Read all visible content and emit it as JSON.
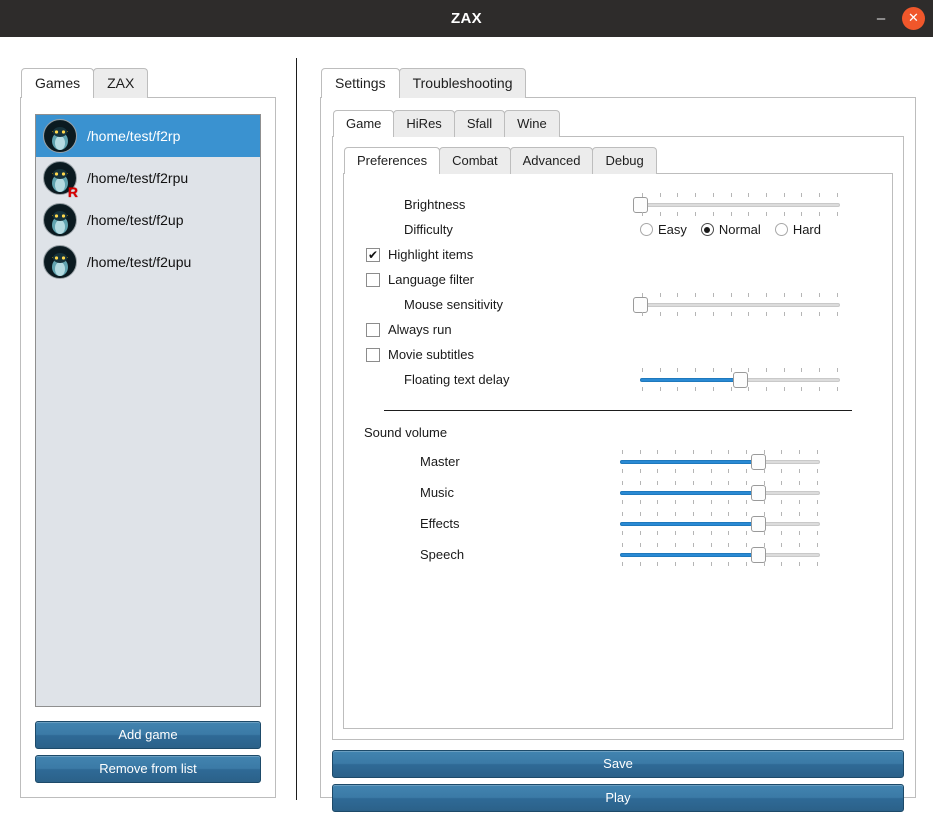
{
  "window": {
    "title": "ZAX",
    "minimize_icon": "minimize-icon",
    "minimize_glyph": "–",
    "close_icon": "close-icon",
    "close_glyph": "✕",
    "titlebar_color": "#2e2c2b",
    "close_color": "#f0572b"
  },
  "left_panel": {
    "tabs": [
      {
        "label": "Games",
        "active": true
      },
      {
        "label": "ZAX",
        "active": false
      }
    ],
    "game_list": [
      {
        "path": "/home/test/f2rp",
        "selected": true,
        "badge": ""
      },
      {
        "path": "/home/test/f2rpu",
        "selected": false,
        "badge": "R"
      },
      {
        "path": "/home/test/f2up",
        "selected": false,
        "badge": ""
      },
      {
        "path": "/home/test/f2upu",
        "selected": false,
        "badge": ""
      }
    ],
    "add_game_label": "Add game",
    "remove_from_list_label": "Remove from list",
    "selection_color": "#3a92d0",
    "list_background": "#dfe3e8"
  },
  "right_panel": {
    "top_tabs": [
      {
        "label": "Settings",
        "active": true
      },
      {
        "label": "Troubleshooting",
        "active": false
      }
    ],
    "settings_tabs": [
      {
        "label": "Game",
        "active": true
      },
      {
        "label": "HiRes",
        "active": false
      },
      {
        "label": "Sfall",
        "active": false
      },
      {
        "label": "Wine",
        "active": false
      }
    ],
    "game_tabs": [
      {
        "label": "Preferences",
        "active": true
      },
      {
        "label": "Combat",
        "active": false
      },
      {
        "label": "Advanced",
        "active": false
      },
      {
        "label": "Debug",
        "active": false
      }
    ],
    "preferences": {
      "brightness": {
        "label": "Brightness",
        "value": 0,
        "min": 0,
        "max": 100
      },
      "difficulty": {
        "label": "Difficulty",
        "options": [
          "Easy",
          "Normal",
          "Hard"
        ],
        "selected": "Normal"
      },
      "highlight_items": {
        "label": "Highlight items",
        "checked": true,
        "glyph": "✔"
      },
      "language_filter": {
        "label": "Language filter",
        "checked": false,
        "glyph": ""
      },
      "mouse_sensitivity": {
        "label": "Mouse sensitivity",
        "value": 0,
        "min": 0,
        "max": 100
      },
      "always_run": {
        "label": "Always run",
        "checked": false,
        "glyph": ""
      },
      "movie_subtitles": {
        "label": "Movie subtitles",
        "checked": false,
        "glyph": ""
      },
      "floating_text_delay": {
        "label": "Floating text delay",
        "value": 50,
        "min": 0,
        "max": 100
      }
    },
    "sound": {
      "section_label": "Sound volume",
      "sliders": [
        {
          "label": "Master",
          "value": 69,
          "min": 0,
          "max": 100
        },
        {
          "label": "Music",
          "value": 69,
          "min": 0,
          "max": 100
        },
        {
          "label": "Effects",
          "value": 69,
          "min": 0,
          "max": 100
        },
        {
          "label": "Speech",
          "value": 69,
          "min": 0,
          "max": 100
        }
      ]
    },
    "save_label": "Save",
    "play_label": "Play",
    "slider_fill_color": "#2a8ad4",
    "button_color": "#3b7aa6"
  }
}
